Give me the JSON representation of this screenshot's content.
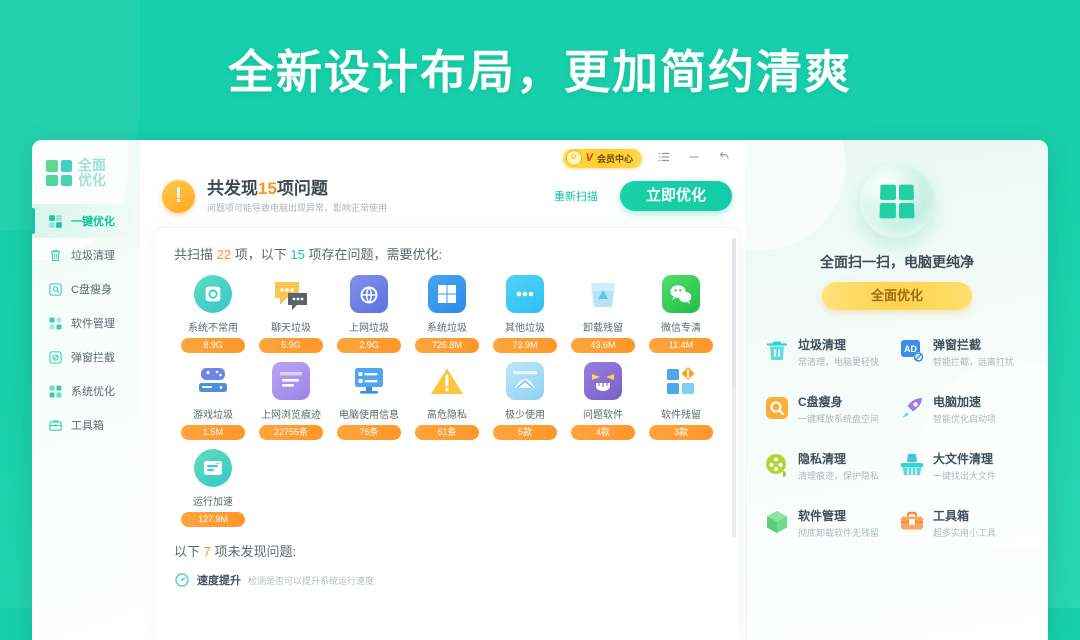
{
  "banner": {
    "title": "全新设计布局，更加简约清爽"
  },
  "app": {
    "logo": {
      "line1": "全面",
      "line2": "优化",
      "icon": "four-square-grid-icon"
    },
    "sidebar": {
      "items": [
        {
          "label": "一键优化",
          "icon": "grid-icon",
          "active": true
        },
        {
          "label": "垃圾清理",
          "icon": "trash-icon",
          "active": false
        },
        {
          "label": "C盘瘦身",
          "icon": "disk-icon",
          "active": false
        },
        {
          "label": "软件管理",
          "icon": "apps-icon",
          "active": false
        },
        {
          "label": "弹窗拦截",
          "icon": "block-icon",
          "active": false
        },
        {
          "label": "系统优化",
          "icon": "tiles-icon",
          "active": false
        },
        {
          "label": "工具箱",
          "icon": "toolbox-icon",
          "active": false
        }
      ]
    },
    "titlebar": {
      "vip": {
        "label": "会员中心",
        "v_badge": "V",
        "avatar_icon": "smiley-avatar-icon"
      },
      "menu_icon": "list-menu-icon",
      "minimize_icon": "minimize-icon",
      "restore_icon": "restore-icon"
    },
    "scan_header": {
      "warn_icon": "exclamation-circle-icon",
      "title_prefix": "共发现",
      "title_count": "15",
      "title_suffix": "项问题",
      "subtitle": "问题项可能导致电脑出现异常，影响正常使用",
      "rescan_label": "重新扫描",
      "optimize_label": "立即优化"
    },
    "result_card": {
      "summary": {
        "p1": "共扫描",
        "total": "22",
        "p2": "项，以下",
        "problems": "15",
        "p3": "项存在问题，需要优化:"
      },
      "tiles": [
        {
          "name": "系统不常用",
          "value": "8.9G",
          "icon": "disk-scan-icon",
          "color1": "#4fd6b8",
          "color2": "#39c9c0",
          "shape": "round"
        },
        {
          "name": "聊天垃圾",
          "value": "5.9G",
          "icon": "chat-bubbles-icon",
          "color1": "#ffc95c",
          "color2": "#f9b73f",
          "shape": "plain"
        },
        {
          "name": "上网垃圾",
          "value": "2.9G",
          "icon": "browser-globe-icon",
          "color1": "#7b8ae8",
          "color2": "#5f72e0",
          "shape": "square"
        },
        {
          "name": "系统垃圾",
          "value": "726.8M",
          "icon": "windows-tile-icon",
          "color1": "#3fa0f0",
          "color2": "#2f8ae8",
          "shape": "square"
        },
        {
          "name": "其他垃圾",
          "value": "73.9M",
          "icon": "window-dots-icon",
          "color1": "#49cdf5",
          "color2": "#2fc0f2",
          "shape": "square"
        },
        {
          "name": "卸载残留",
          "value": "43.6M",
          "icon": "recycle-bin-icon",
          "color1": "#ffffff",
          "color2": "#ffffff",
          "shape": "plain"
        },
        {
          "name": "微信专清",
          "value": "11.4M",
          "icon": "wechat-icon",
          "color1": "#4cd964",
          "color2": "#22c04a",
          "shape": "square"
        },
        {
          "name": "游戏垃圾",
          "value": "1.5M",
          "icon": "gamepad-icon",
          "color1": "#6e86e8",
          "color2": "#5670e0",
          "shape": "plain"
        },
        {
          "name": "上网浏览痕迹",
          "value": "22755条",
          "icon": "browser-lines-icon",
          "color1": "#b39ef0",
          "color2": "#9a83e8",
          "shape": "square"
        },
        {
          "name": "电脑使用信息",
          "value": "76条",
          "icon": "monitor-list-icon",
          "color1": "#5fb6f5",
          "color2": "#3f9ae8",
          "shape": "plain"
        },
        {
          "name": "高危隐私",
          "value": "61条",
          "icon": "warning-triangle-icon",
          "color1": "#ffc93c",
          "color2": "#f5a623",
          "shape": "plain"
        },
        {
          "name": "极少使用",
          "value": "5款",
          "icon": "window-chart-icon",
          "color1": "#9fd8f5",
          "color2": "#7ec8ef",
          "shape": "square"
        },
        {
          "name": "问题软件",
          "value": "4款",
          "icon": "evil-face-icon",
          "color1": "#8e72d6",
          "color2": "#7a5fc8",
          "shape": "square"
        },
        {
          "name": "软件残留",
          "value": "3款",
          "icon": "tiles-alert-icon",
          "color1": "#4fa8e8",
          "color2": "#3f96e0",
          "shape": "plain"
        },
        {
          "name": "运行加速",
          "value": "127.9M",
          "icon": "speed-card-icon",
          "color1": "#5fd6b8",
          "color2": "#3fc9c4",
          "shape": "round"
        }
      ],
      "ok_section": {
        "p1": "以下",
        "count": "7",
        "p2": "项未发现问题:",
        "rows": [
          {
            "icon": "speedometer-icon",
            "name": "速度提升",
            "desc": "检测是否可以提升系统运行速度"
          }
        ]
      }
    },
    "right_panel": {
      "sphere_icon": "four-square-sphere-icon",
      "tagline": "全面扫一扫，电脑更纯净",
      "button_label": "全面优化",
      "features": [
        {
          "name": "垃圾清理",
          "desc": "常清理，电脑更轻快",
          "icon": "trash-icon",
          "color": "#2fd4d0"
        },
        {
          "name": "弹窗拦截",
          "desc": "智能拦截，远离打扰",
          "icon": "ad-block-icon",
          "color": "#3f8ae8"
        },
        {
          "name": "C盘瘦身",
          "desc": "一键释放系统盘空间",
          "icon": "disk-search-icon",
          "color": "#f5a623"
        },
        {
          "name": "电脑加速",
          "desc": "智能优化启动项",
          "icon": "rocket-icon",
          "color": "#9a7ff0"
        },
        {
          "name": "隐私清理",
          "desc": "清理痕迹，保护隐私",
          "icon": "privacy-film-icon",
          "color": "#b5d334"
        },
        {
          "name": "大文件清理",
          "desc": "一键找出大文件",
          "icon": "broom-icon",
          "color": "#2fd4cb"
        },
        {
          "name": "软件管理",
          "desc": "彻底卸载软件无残留",
          "icon": "box-icon",
          "color": "#5ed17a"
        },
        {
          "name": "工具箱",
          "desc": "超多实用小工具",
          "icon": "toolbox-icon",
          "color": "#f5a050"
        }
      ]
    }
  }
}
